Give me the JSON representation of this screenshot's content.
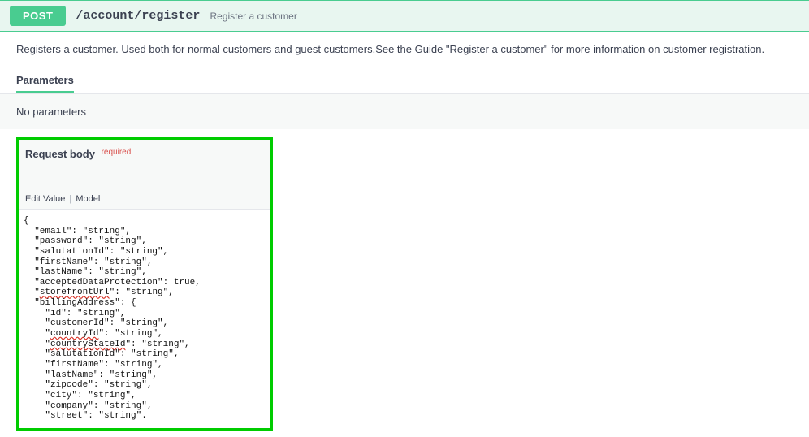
{
  "endpoint": {
    "method": "POST",
    "path": "/account/register",
    "summary": "Register a customer"
  },
  "description": "Registers a customer. Used both for normal customers and guest customers.See the Guide \"Register a customer\" for more information on customer registration.",
  "tabs": {
    "parameters": "Parameters"
  },
  "parameters": {
    "none_label": "No parameters"
  },
  "request_body": {
    "title": "Request body",
    "required_label": "required",
    "edit_value_tab": "Edit Value",
    "model_tab": "Model",
    "code_lines": [
      {
        "t": "{",
        "i": 0
      },
      {
        "t": "\"email\": \"string\",",
        "i": 1
      },
      {
        "t": "\"password\": \"string\",",
        "i": 1
      },
      {
        "t": "\"salutationId\": \"string\",",
        "i": 1
      },
      {
        "t": "\"firstName\": \"string\",",
        "i": 1
      },
      {
        "t": "\"lastName\": \"string\",",
        "i": 1
      },
      {
        "t": "\"acceptedDataProtection\": true,",
        "i": 1
      },
      {
        "t": "\"",
        "i": 1,
        "k": "storefrontUrl",
        "r": "\": \"string\","
      },
      {
        "t": "\"billingAddress\": {",
        "i": 1
      },
      {
        "t": "\"id\": \"string\",",
        "i": 2
      },
      {
        "t": "\"customerId\": \"string\",",
        "i": 2
      },
      {
        "t": "\"",
        "i": 2,
        "k": "countryId",
        "r": "\": \"string\","
      },
      {
        "t": "\"",
        "i": 2,
        "k": "countryStateId",
        "r": "\": \"string\","
      },
      {
        "t": "\"salutationId\": \"string\",",
        "i": 2
      },
      {
        "t": "\"firstName\": \"string\",",
        "i": 2
      },
      {
        "t": "\"lastName\": \"string\",",
        "i": 2
      },
      {
        "t": "\"zipcode\": \"string\",",
        "i": 2
      },
      {
        "t": "\"city\": \"string\",",
        "i": 2
      },
      {
        "t": "\"company\": \"string\",",
        "i": 2
      },
      {
        "t": "\"street\": \"string\".",
        "i": 2
      }
    ]
  }
}
